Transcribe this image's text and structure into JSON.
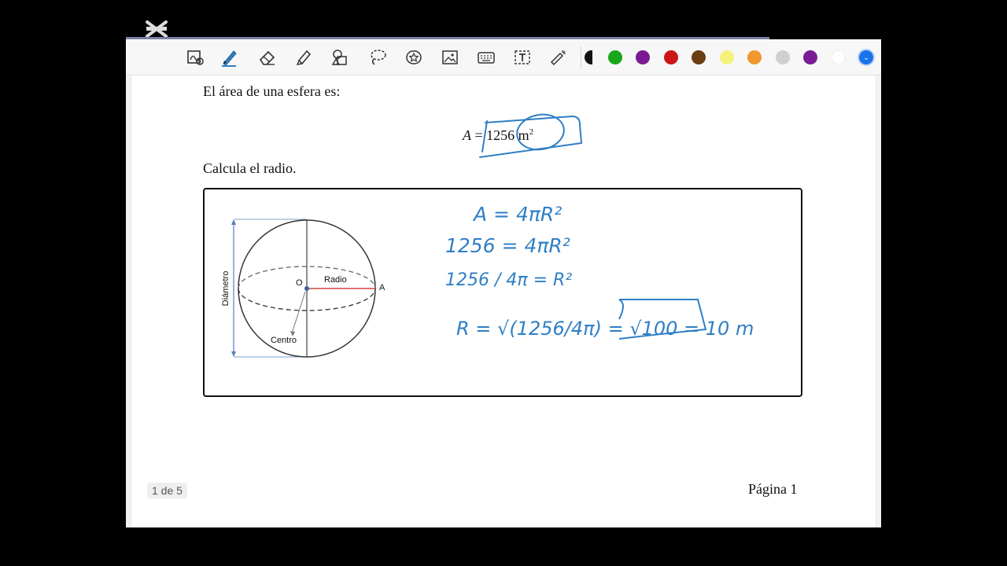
{
  "toolbar": {
    "tools": [
      {
        "name": "lasso-text-icon"
      },
      {
        "name": "pen-icon"
      },
      {
        "name": "eraser-icon"
      },
      {
        "name": "highlighter-icon"
      },
      {
        "name": "shapes-icon"
      },
      {
        "name": "lasso-icon"
      },
      {
        "name": "sticker-icon"
      },
      {
        "name": "image-icon"
      },
      {
        "name": "keyboard-icon"
      },
      {
        "name": "text-icon"
      },
      {
        "name": "laser-pointer-icon"
      }
    ],
    "colors": [
      "#121212",
      "#1aa61a",
      "#7b1b94",
      "#cc1717",
      "#6a3d12",
      "#f4f27a",
      "#f0982e",
      "#cfcfcf",
      "#7b1b94",
      "#ffffff",
      "#1a73e8"
    ],
    "selected_color": "#1a73e8"
  },
  "document": {
    "intro": "El área de una esfera es:",
    "formula_lhs": "A",
    "formula_eq": "=",
    "formula_value": "1256",
    "formula_unit": "m",
    "formula_exp": "2",
    "question": "Calcula el radio.",
    "diagram": {
      "label_diameter": "Diámetro",
      "label_center_point": "O",
      "label_radius": "Radio",
      "label_point_a": "A",
      "label_center": "Centro"
    },
    "handwriting": {
      "line1": "A = 4πR²",
      "line2": "1256 = 4πR²",
      "line3": "1256 / 4π = R²",
      "line4": "R = √(1256/4π) = √100 = 10 m"
    },
    "page_counter": "1 de 5",
    "footer": "Página 1"
  },
  "ink_color": "#2f7fc6"
}
